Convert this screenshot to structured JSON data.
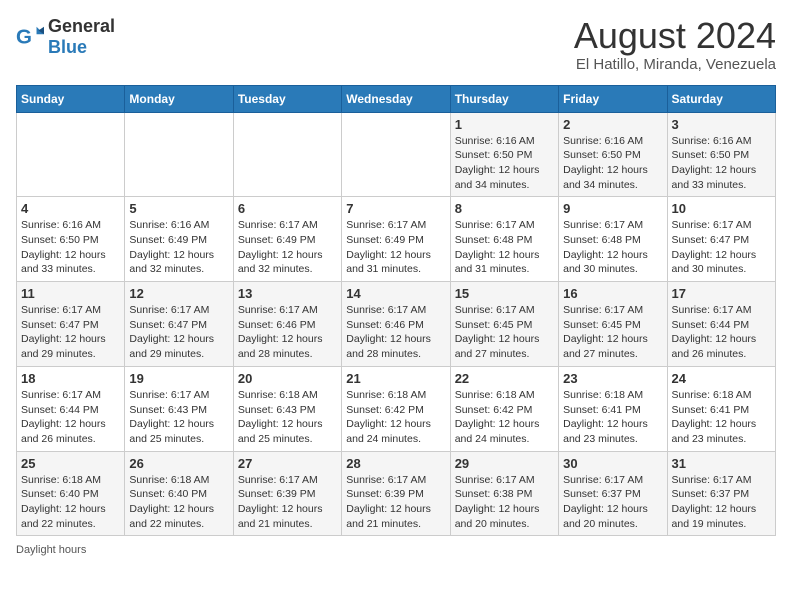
{
  "header": {
    "logo_general": "General",
    "logo_blue": "Blue",
    "title": "August 2024",
    "subtitle": "El Hatillo, Miranda, Venezuela"
  },
  "days_of_week": [
    "Sunday",
    "Monday",
    "Tuesday",
    "Wednesday",
    "Thursday",
    "Friday",
    "Saturday"
  ],
  "weeks": [
    [
      {
        "day": "",
        "info": ""
      },
      {
        "day": "",
        "info": ""
      },
      {
        "day": "",
        "info": ""
      },
      {
        "day": "",
        "info": ""
      },
      {
        "day": "1",
        "info": "Sunrise: 6:16 AM\nSunset: 6:50 PM\nDaylight: 12 hours\nand 34 minutes."
      },
      {
        "day": "2",
        "info": "Sunrise: 6:16 AM\nSunset: 6:50 PM\nDaylight: 12 hours\nand 34 minutes."
      },
      {
        "day": "3",
        "info": "Sunrise: 6:16 AM\nSunset: 6:50 PM\nDaylight: 12 hours\nand 33 minutes."
      }
    ],
    [
      {
        "day": "4",
        "info": "Sunrise: 6:16 AM\nSunset: 6:50 PM\nDaylight: 12 hours\nand 33 minutes."
      },
      {
        "day": "5",
        "info": "Sunrise: 6:16 AM\nSunset: 6:49 PM\nDaylight: 12 hours\nand 32 minutes."
      },
      {
        "day": "6",
        "info": "Sunrise: 6:17 AM\nSunset: 6:49 PM\nDaylight: 12 hours\nand 32 minutes."
      },
      {
        "day": "7",
        "info": "Sunrise: 6:17 AM\nSunset: 6:49 PM\nDaylight: 12 hours\nand 31 minutes."
      },
      {
        "day": "8",
        "info": "Sunrise: 6:17 AM\nSunset: 6:48 PM\nDaylight: 12 hours\nand 31 minutes."
      },
      {
        "day": "9",
        "info": "Sunrise: 6:17 AM\nSunset: 6:48 PM\nDaylight: 12 hours\nand 30 minutes."
      },
      {
        "day": "10",
        "info": "Sunrise: 6:17 AM\nSunset: 6:47 PM\nDaylight: 12 hours\nand 30 minutes."
      }
    ],
    [
      {
        "day": "11",
        "info": "Sunrise: 6:17 AM\nSunset: 6:47 PM\nDaylight: 12 hours\nand 29 minutes."
      },
      {
        "day": "12",
        "info": "Sunrise: 6:17 AM\nSunset: 6:47 PM\nDaylight: 12 hours\nand 29 minutes."
      },
      {
        "day": "13",
        "info": "Sunrise: 6:17 AM\nSunset: 6:46 PM\nDaylight: 12 hours\nand 28 minutes."
      },
      {
        "day": "14",
        "info": "Sunrise: 6:17 AM\nSunset: 6:46 PM\nDaylight: 12 hours\nand 28 minutes."
      },
      {
        "day": "15",
        "info": "Sunrise: 6:17 AM\nSunset: 6:45 PM\nDaylight: 12 hours\nand 27 minutes."
      },
      {
        "day": "16",
        "info": "Sunrise: 6:17 AM\nSunset: 6:45 PM\nDaylight: 12 hours\nand 27 minutes."
      },
      {
        "day": "17",
        "info": "Sunrise: 6:17 AM\nSunset: 6:44 PM\nDaylight: 12 hours\nand 26 minutes."
      }
    ],
    [
      {
        "day": "18",
        "info": "Sunrise: 6:17 AM\nSunset: 6:44 PM\nDaylight: 12 hours\nand 26 minutes."
      },
      {
        "day": "19",
        "info": "Sunrise: 6:17 AM\nSunset: 6:43 PM\nDaylight: 12 hours\nand 25 minutes."
      },
      {
        "day": "20",
        "info": "Sunrise: 6:18 AM\nSunset: 6:43 PM\nDaylight: 12 hours\nand 25 minutes."
      },
      {
        "day": "21",
        "info": "Sunrise: 6:18 AM\nSunset: 6:42 PM\nDaylight: 12 hours\nand 24 minutes."
      },
      {
        "day": "22",
        "info": "Sunrise: 6:18 AM\nSunset: 6:42 PM\nDaylight: 12 hours\nand 24 minutes."
      },
      {
        "day": "23",
        "info": "Sunrise: 6:18 AM\nSunset: 6:41 PM\nDaylight: 12 hours\nand 23 minutes."
      },
      {
        "day": "24",
        "info": "Sunrise: 6:18 AM\nSunset: 6:41 PM\nDaylight: 12 hours\nand 23 minutes."
      }
    ],
    [
      {
        "day": "25",
        "info": "Sunrise: 6:18 AM\nSunset: 6:40 PM\nDaylight: 12 hours\nand 22 minutes."
      },
      {
        "day": "26",
        "info": "Sunrise: 6:18 AM\nSunset: 6:40 PM\nDaylight: 12 hours\nand 22 minutes."
      },
      {
        "day": "27",
        "info": "Sunrise: 6:17 AM\nSunset: 6:39 PM\nDaylight: 12 hours\nand 21 minutes."
      },
      {
        "day": "28",
        "info": "Sunrise: 6:17 AM\nSunset: 6:39 PM\nDaylight: 12 hours\nand 21 minutes."
      },
      {
        "day": "29",
        "info": "Sunrise: 6:17 AM\nSunset: 6:38 PM\nDaylight: 12 hours\nand 20 minutes."
      },
      {
        "day": "30",
        "info": "Sunrise: 6:17 AM\nSunset: 6:37 PM\nDaylight: 12 hours\nand 20 minutes."
      },
      {
        "day": "31",
        "info": "Sunrise: 6:17 AM\nSunset: 6:37 PM\nDaylight: 12 hours\nand 19 minutes."
      }
    ]
  ],
  "footer": {
    "daylight_label": "Daylight hours"
  }
}
